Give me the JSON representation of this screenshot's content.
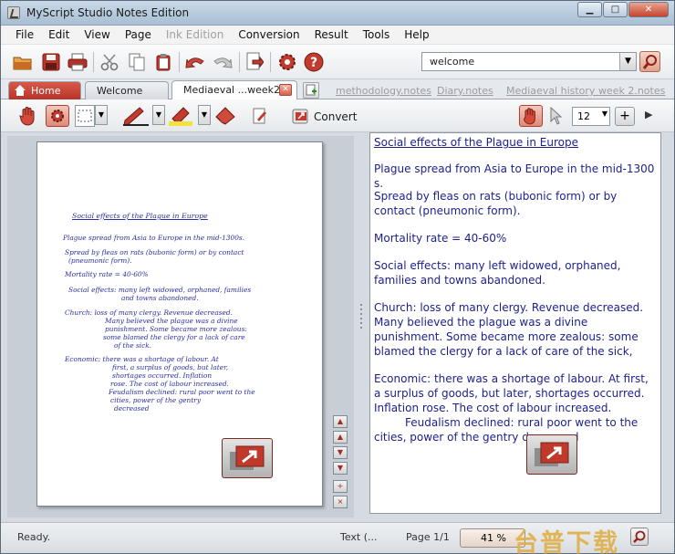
{
  "window": {
    "title": "MyScript Studio Notes Edition",
    "min": "▁",
    "max": "□",
    "close": "✕"
  },
  "menu": [
    "File",
    "Edit",
    "View",
    "Page",
    "Ink Edition",
    "Conversion",
    "Result",
    "Tools",
    "Help"
  ],
  "search": {
    "value": "welcome"
  },
  "tabs": {
    "home": "Home",
    "welcome": "Welcome",
    "active": "Mediaeval ...week2",
    "links": [
      "methodology.notes",
      "Diary.notes",
      "Mediaeval history week 2.notes"
    ]
  },
  "toolbar2": {
    "convert_label": "Convert",
    "size_value": "12",
    "plus": "+",
    "more": "▶"
  },
  "ink": {
    "lines": [
      "Social effects of the Plague in Europe",
      "Plague spread from Asia to Europe in the mid-1300s.",
      "Spread by fleas on rats (bubonic form) or by contact",
      "(pneumonic form).",
      "Mortality rate = 40-60%",
      "Social effects: many left widowed, orphaned, families",
      "and towns abandoned.",
      "Church: loss of many clergy. Revenue decreased.",
      "Many believed the plague was a divine",
      "punishment. Some became more zealous:",
      "some blamed the clergy for a lack of care",
      "of the sick.",
      "Economic: there was a shortage of labour. At",
      "first, a surplus of goods, but later,",
      "shortages occurred. Inflation",
      "rose. The cost of labour increased.",
      "Feudalism declined: rural poor went to the",
      "cities, power of the gentry",
      "decreased"
    ]
  },
  "text": {
    "title": "Social effects of the Plague in Europe",
    "p1": "Plague spread from Asia to Europe in the mid-1300 s.",
    "p2": "Spread by fleas on rats (bubonic form) or by contact (pneumonic form).",
    "p3": "Mortality rate = 40-60%",
    "p4": "Social effects: many left widowed, orphaned, families and towns abandoned.",
    "p5": "Church: loss of many clergy. Revenue decreased. Many believed the plague was a divine punishment. Some became more zealous: some blamed the clergy for a lack of care of the sick,",
    "p6": "Economic: there was a shortage of labour. At first, a surplus of goods, but later, shortages occurred. Inflation rose. The cost of labour increased.",
    "p7": "Feudalism declined: rural poor went to the cities, power of the gentry decreased"
  },
  "status": {
    "ready": "Ready.",
    "mode": "Text (...",
    "page": "Page 1/1",
    "zoom": "41 %",
    "watermark": "台普下载"
  },
  "icons": [
    "open-icon",
    "save-icon",
    "print-icon",
    "cut-icon",
    "copy-icon",
    "paste-icon",
    "undo-icon",
    "redo-icon",
    "export-icon",
    "settings-icon",
    "help-icon",
    "search-icon",
    "hand-icon",
    "pen-icon",
    "highlighter-icon",
    "eraser-icon",
    "select-icon",
    "convert-icon",
    "home-icon"
  ],
  "colors": {
    "accent": "#c0392b",
    "ink": "#2a2f9e",
    "text": "#1c1f8a"
  }
}
